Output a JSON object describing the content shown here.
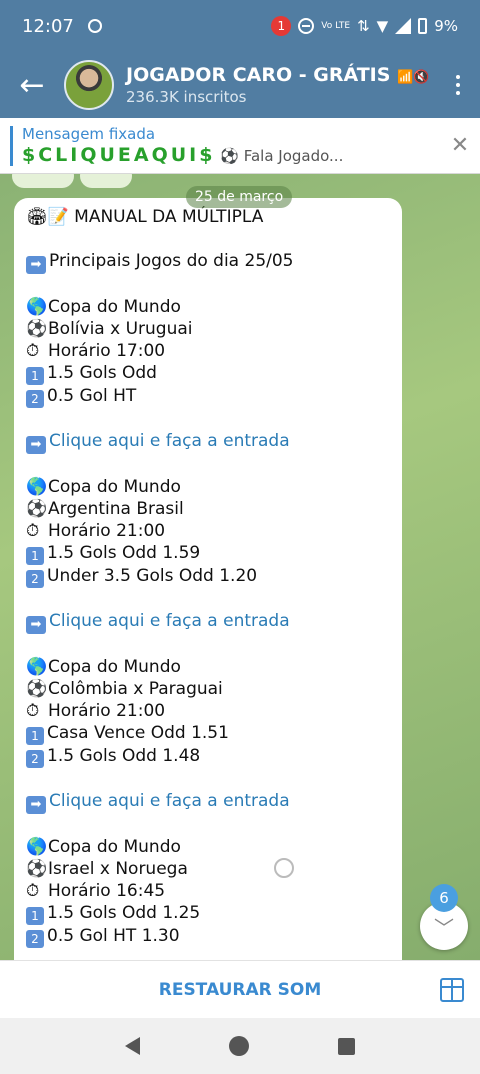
{
  "status_bar": {
    "time": "12:07",
    "notification_count": "1",
    "volte": "Vo LTE",
    "battery": "9%"
  },
  "header": {
    "title": "JOGADOR CARO - GRÁTIS",
    "title_icons": "📶🔇",
    "subtitle": "236.3K inscritos"
  },
  "pinned": {
    "label": "Mensagem fixada",
    "highlight": "$CLIQUEAQUI$",
    "preview": "⚽ Fala Jogado..."
  },
  "chat": {
    "date": "25 de março",
    "message": {
      "title_emoji": "🏟📝",
      "title": "MANUAL DA MÚLTIPLA",
      "intro": "Principais Jogos do dia 25/05",
      "link_text": "Clique aqui e faça a entrada",
      "games": [
        {
          "competition": "Copa do Mundo",
          "match": "Bolívia x Uruguai",
          "time": "Horário 17:00",
          "tip1": "1.5 Gols Odd",
          "tip2": "0.5 Gol HT"
        },
        {
          "competition": "Copa do Mundo",
          "match": "Argentina Brasil",
          "time": "Horário 21:00",
          "tip1": "1.5 Gols Odd 1.59",
          "tip2": "Under 3.5 Gols Odd 1.20"
        },
        {
          "competition": "Copa do Mundo",
          "match": "Colômbia x Paraguai",
          "time": "Horário 21:00",
          "tip1": "Casa Vence Odd 1.51",
          "tip2": "1.5 Gols Odd 1.48"
        },
        {
          "competition": "Copa do Mundo",
          "match": "Israel x Noruega",
          "time": "Horário 16:45",
          "tip1": "1.5 Gols Odd 1.25",
          "tip2": "0.5 Gol HT 1.30"
        }
      ]
    },
    "unread_count": "6"
  },
  "bottom_bar": {
    "restore_label": "RESTAURAR SOM"
  },
  "icons": {
    "globe": "🌎",
    "ball": "⚽",
    "timer": "⏱",
    "one": "1",
    "two": "2",
    "arrow": "➡"
  }
}
